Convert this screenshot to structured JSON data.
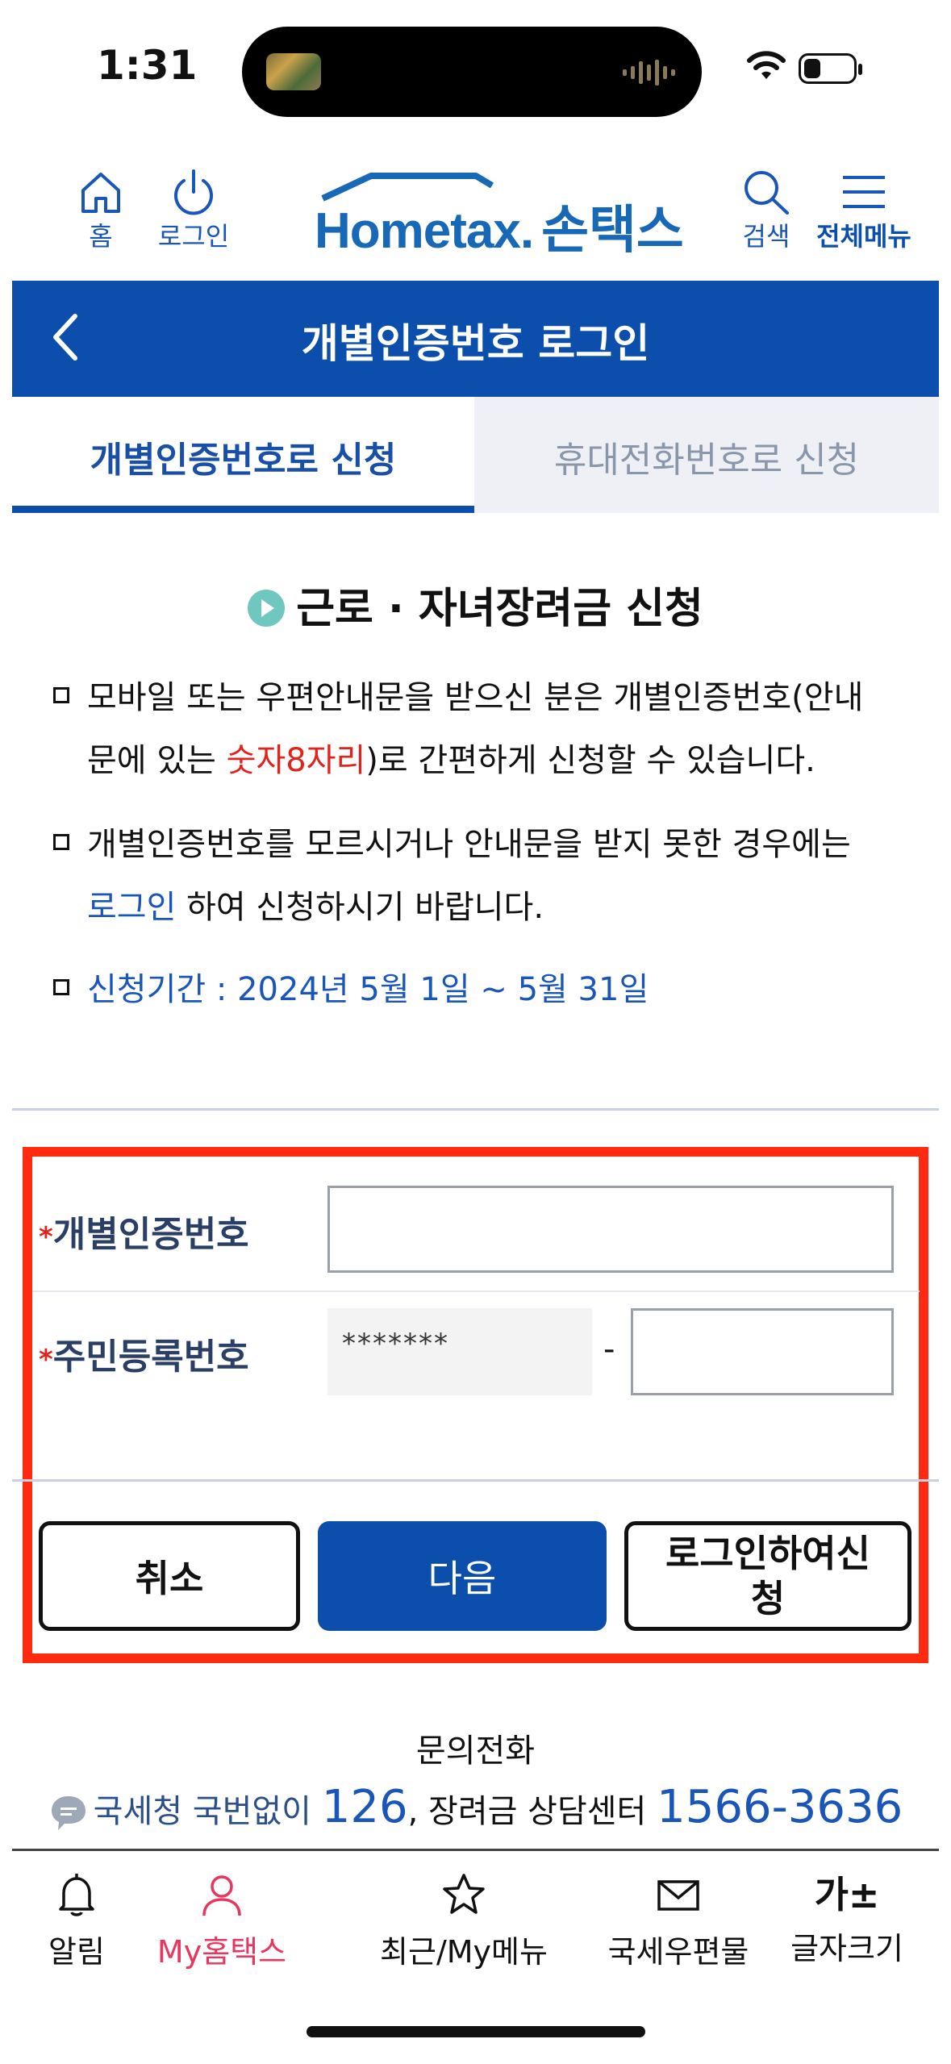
{
  "status": {
    "time": "1:31"
  },
  "header": {
    "home_label": "홈",
    "login_label": "로그인",
    "logo_brand": "Hometax.",
    "logo_korean": "손택스",
    "search_label": "검색",
    "menu_label": "전체메뉴"
  },
  "titlebar": {
    "title": "개별인증번호 로그인"
  },
  "tabs": [
    {
      "label": "개별인증번호로 신청",
      "active": true
    },
    {
      "label": "휴대전화번호로 신청",
      "active": false
    }
  ],
  "section": {
    "title": "근로 · 자녀장려금 신청",
    "bullet1_line1": "모바일 또는 우편안내문을 받으신 분은 개별인증번호(안내",
    "bullet1_line2_a": "문에 있는 ",
    "bullet1_line2_red": "숫자8자리",
    "bullet1_line2_b": ")로 간편하게 신청할 수 있습니다.",
    "bullet2_line1": "개별인증번호를 모르시거나 안내문을 받지 못한 경우에는",
    "bullet2_line2_link": "로그인",
    "bullet2_line2_b": " 하여 신청하시기 바랍니다.",
    "bullet3": "신청기간 : 2024년 5월 1일 ~ 5월 31일"
  },
  "form": {
    "auth_label": "개별인증번호",
    "auth_value": "",
    "rrn_label": "주민등록번호",
    "rrn_front": "*******",
    "rrn_separator": "-",
    "rrn_back": "",
    "required_mark": "*"
  },
  "buttons": {
    "cancel": "취소",
    "next": "다음",
    "login_apply_line1": "로그인하여신",
    "login_apply_line2": "청"
  },
  "contact": {
    "title": "문의전화",
    "nts": "국세청 국번없이 ",
    "nts_number": "126",
    "center": ", 장려금 상담센터 ",
    "center_number": "1566-3636"
  },
  "tabbar": {
    "items": [
      {
        "label": "알림",
        "icon": "bell-icon"
      },
      {
        "label": "My홈택스",
        "icon": "person-icon",
        "color": "#e8365e"
      },
      {
        "label": "최근/My메뉴",
        "icon": "star-icon"
      },
      {
        "label": "국세우편물",
        "icon": "mail-icon"
      },
      {
        "label": "글자크기",
        "icon": "font-size-icon",
        "glyph": "가±"
      }
    ]
  }
}
